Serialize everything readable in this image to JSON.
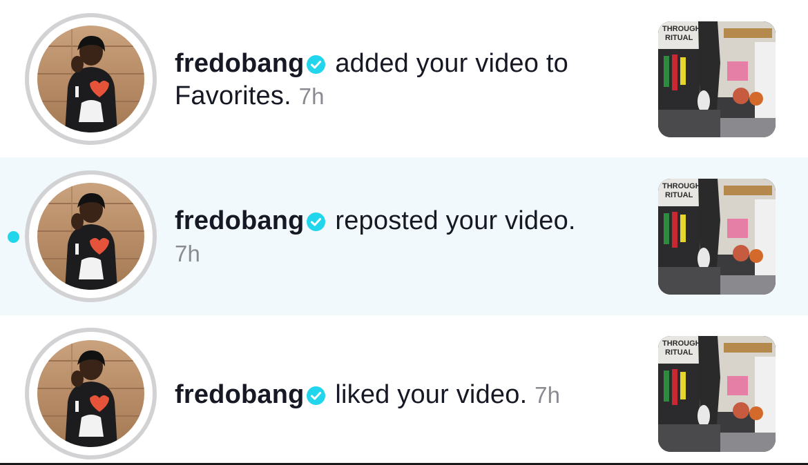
{
  "accent_color": "#20d5ec",
  "unread_background": "#f1f9fd",
  "notifications": [
    {
      "username": "fredobang",
      "verified": true,
      "verified_icon": "verified-badge-icon",
      "action": "added your video to Favorites.",
      "timestamp": "7h",
      "unread": false
    },
    {
      "username": "fredobang",
      "verified": true,
      "verified_icon": "verified-badge-icon",
      "action": "reposted your video.",
      "timestamp": "7h",
      "unread": true
    },
    {
      "username": "fredobang",
      "verified": true,
      "verified_icon": "verified-badge-icon",
      "action": "liked your video.",
      "timestamp": "7h",
      "unread": false
    }
  ],
  "thumbnail_sign": {
    "line1": "THROUGH",
    "line2": "RITUAL"
  }
}
